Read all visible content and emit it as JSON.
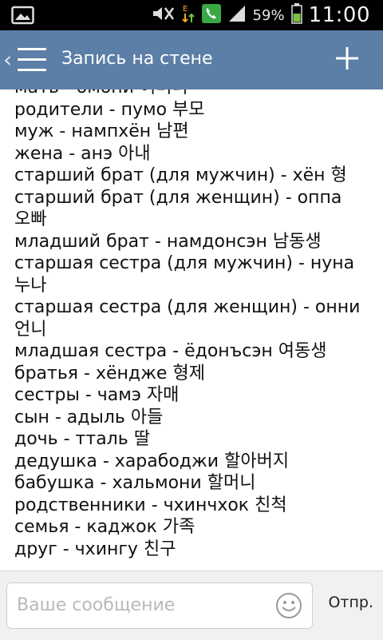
{
  "status_bar": {
    "icons": [
      "image-icon",
      "silent-mode-icon",
      "data-transfer-icon",
      "phone-icon",
      "signal-icon",
      "battery-icon"
    ],
    "battery": "59%",
    "time": "11:00"
  },
  "action_bar": {
    "title": "Запись на стене",
    "color": "#5b7fa6"
  },
  "content": {
    "lines": [
      "мать - омони 어머니",
      "родители - пумо 부모",
      "муж - нампхён 남편",
      "жена - анэ 아내",
      "старший брат (для мужчин) - хён 형",
      "старший брат (для женщин) - оппа",
      "오빠",
      "младший брат - намдонсэн 남동생",
      "старшая сестра (для мужчин) - нуна",
      "누나",
      "старшая сестра (для женщин) - онни",
      "언니",
      "младшая сестра - ёдонъсэн 여동생",
      "братья - хёндже 형제",
      "сестры - чамэ 자매",
      "сын - адыль 아들",
      "дочь - тталь 딸",
      "дедушка - харабоджи 할아버지",
      "бабушка - хальмони 할머니",
      "родственники - чхинчхок 친척",
      "семья - каджок 가족",
      "друг - чхингу 친구",
      "..."
    ]
  },
  "composer": {
    "placeholder": "Ваше сообщение",
    "send_label": "Отпр."
  }
}
